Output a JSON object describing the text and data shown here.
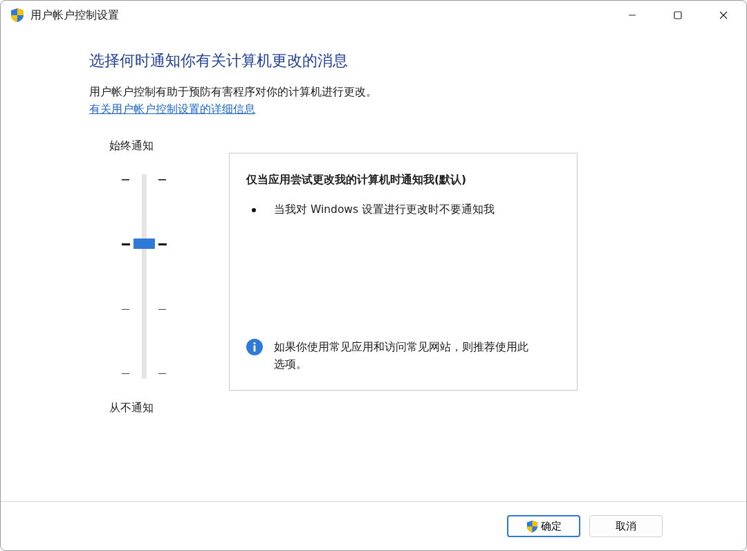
{
  "window": {
    "title": "用户帐户控制设置"
  },
  "heading": "选择何时通知你有关计算机更改的消息",
  "description": "用户帐户控制有助于预防有害程序对你的计算机进行更改。",
  "link": "有关用户帐户控制设置的详细信息",
  "slider": {
    "top_label": "始终通知",
    "bottom_label": "从不通知",
    "level": 0.667
  },
  "info_panel": {
    "title": "仅当应用尝试更改我的计算机时通知我(默认)",
    "bullets": [
      "当我对 Windows 设置进行更改时不要通知我"
    ],
    "note": "如果你使用常见应用和访问常见网站，则推荐使用此选项。"
  },
  "buttons": [
    {
      "label": "确定",
      "kind": "shield"
    },
    {
      "label": "取消",
      "kind": "plain"
    }
  ]
}
